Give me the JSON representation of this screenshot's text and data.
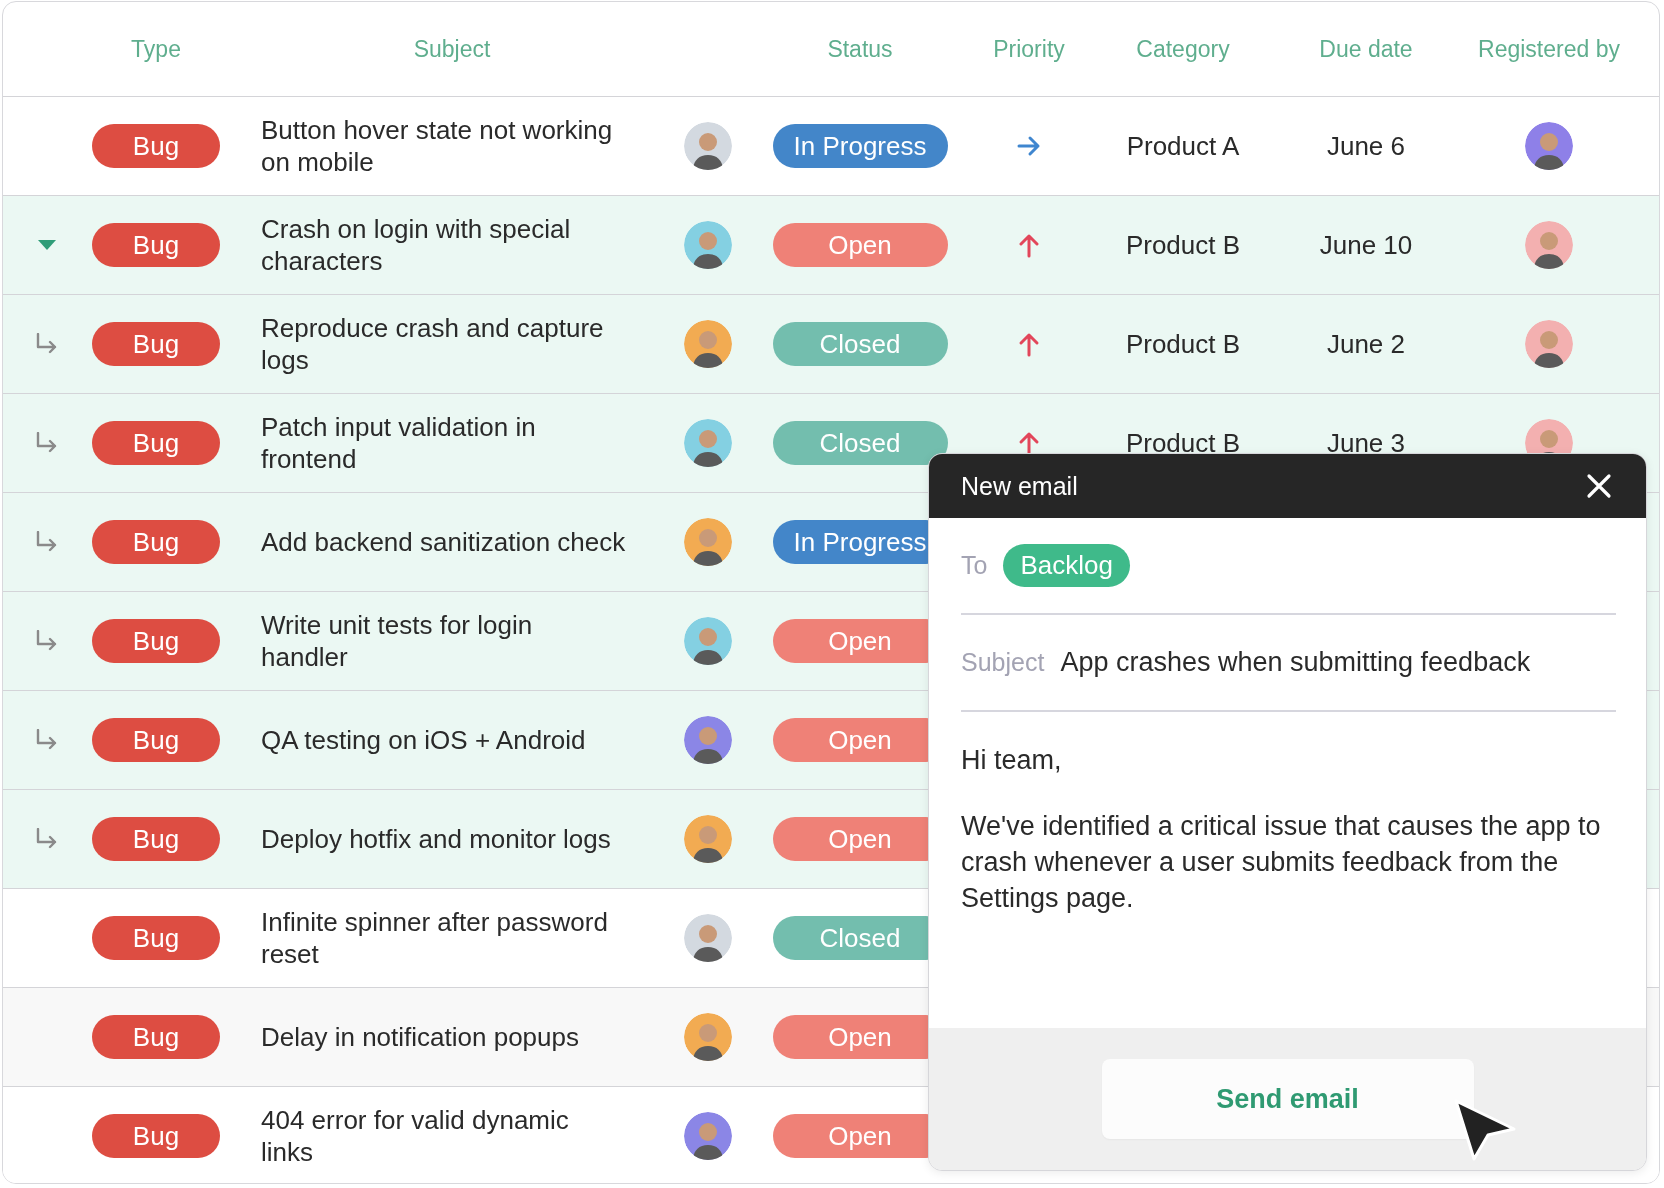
{
  "table": {
    "columns": [
      "Type",
      "Subject",
      "Status",
      "Priority",
      "Category",
      "Due date",
      "Registered by"
    ],
    "rows": [
      {
        "kind": "plain",
        "type": "Bug",
        "subject": "Button hover state not working\non mobile",
        "assignee": {
          "color": "#d3d9e0"
        },
        "status": {
          "label": "In Progress",
          "kind": "in_progress"
        },
        "priority": {
          "kind": "normal"
        },
        "category": "Product A",
        "due": "June 6",
        "reporter": {
          "color": "#8e80e8"
        }
      },
      {
        "kind": "group",
        "tree": {
          "kind": "parent",
          "expanded": true
        },
        "type": "Bug",
        "subject": "Crash on login with special\ncharacters",
        "assignee": {
          "color": "#84d0e2"
        },
        "status": {
          "label": "Open",
          "kind": "open"
        },
        "priority": {
          "kind": "high"
        },
        "category": "Product B",
        "due": "June 10",
        "reporter": {
          "color": "#f3b0b0"
        }
      },
      {
        "kind": "group",
        "tree": {
          "kind": "child"
        },
        "type": "Bug",
        "subject": "Reproduce crash and capture\nlogs",
        "assignee": {
          "color": "#f2ab52"
        },
        "status": {
          "label": "Closed",
          "kind": "closed"
        },
        "priority": {
          "kind": "high"
        },
        "category": "Product B",
        "due": "June 2",
        "reporter": {
          "color": "#f3b0b0"
        }
      },
      {
        "kind": "group",
        "tree": {
          "kind": "child"
        },
        "type": "Bug",
        "subject": "Patch input validation in\nfrontend",
        "assignee": {
          "color": "#84d0e2"
        },
        "status": {
          "label": "Closed",
          "kind": "closed"
        },
        "priority": {
          "kind": "high"
        },
        "category": "Product B",
        "due": "June 3",
        "reporter": {
          "color": "#f3b0b0"
        }
      },
      {
        "kind": "group",
        "tree": {
          "kind": "child"
        },
        "type": "Bug",
        "subject": "Add backend sanitization check",
        "assignee": {
          "color": "#f2ab52"
        },
        "status": {
          "label": "In Progress",
          "kind": "in_progress"
        }
      },
      {
        "kind": "group",
        "tree": {
          "kind": "child"
        },
        "type": "Bug",
        "subject": "Write unit tests for login\nhandler",
        "assignee": {
          "color": "#84d0e2"
        },
        "status": {
          "label": "Open",
          "kind": "open"
        }
      },
      {
        "kind": "group",
        "tree": {
          "kind": "child"
        },
        "type": "Bug",
        "subject": "QA testing on iOS + Android",
        "assignee": {
          "color": "#8b86e6"
        },
        "status": {
          "label": "Open",
          "kind": "open"
        }
      },
      {
        "kind": "group",
        "tree": {
          "kind": "child"
        },
        "type": "Bug",
        "subject": "Deploy hotfix and monitor logs",
        "assignee": {
          "color": "#f2ab52"
        },
        "status": {
          "label": "Open",
          "kind": "open"
        }
      },
      {
        "kind": "plain",
        "type": "Bug",
        "subject": "Infinite spinner after password\nreset",
        "assignee": {
          "color": "#d3d9e0"
        },
        "status": {
          "label": "Closed",
          "kind": "closed"
        }
      },
      {
        "kind": "hovered",
        "type": "Bug",
        "subject": "Delay in notification popups",
        "assignee": {
          "color": "#f2ab52"
        },
        "status": {
          "label": "Open",
          "kind": "open"
        }
      },
      {
        "kind": "plain",
        "type": "Bug",
        "subject": "404 error for valid dynamic\nlinks",
        "assignee": {
          "color": "#8b86e6"
        },
        "status": {
          "label": "Open",
          "kind": "open"
        }
      }
    ]
  },
  "email": {
    "title": "New email",
    "to_label": "To",
    "recipient": "Backlog",
    "subject_label": "Subject",
    "subject": "App crashes when submitting feedback",
    "body": [
      "Hi team,",
      "We've identified a critical issue that causes the app to crash whenever a user submits feedback from the Settings page."
    ],
    "send_button": "Send email"
  }
}
